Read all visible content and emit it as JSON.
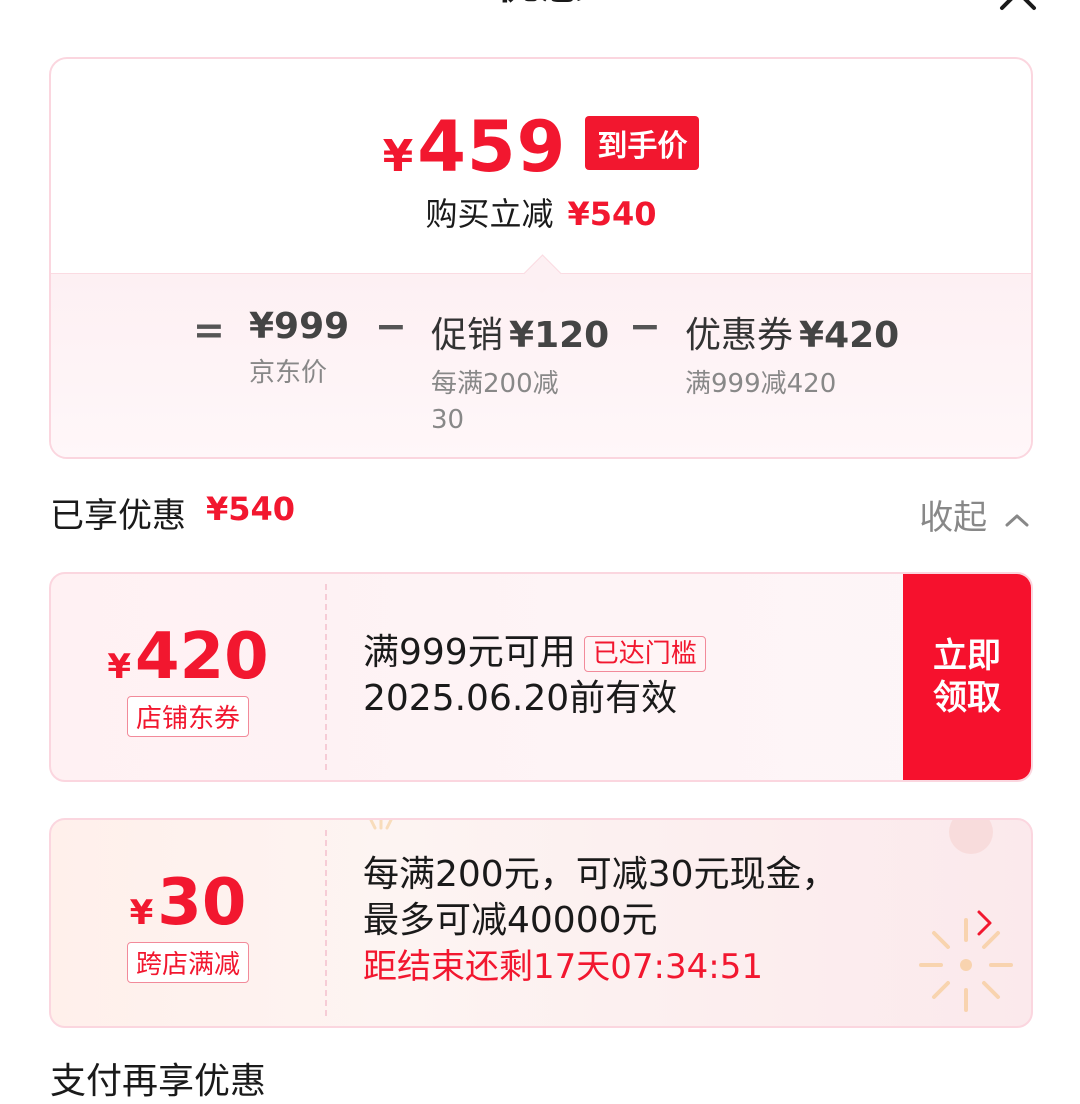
{
  "header": {
    "title": "优惠"
  },
  "summary": {
    "final_price_currency": "¥",
    "final_price": "459",
    "final_tag": "到手价",
    "save_label": "购买立减",
    "save_amount": "¥540",
    "formula": {
      "equals": "=",
      "minus": "−",
      "jd_price": "¥999",
      "jd_price_label": "京东价",
      "promo_prefix": "促销",
      "promo_amount": "¥120",
      "promo_desc": "每满200减30",
      "coupon_prefix": "优惠券",
      "coupon_amount": "¥420",
      "coupon_desc": "满999减420"
    }
  },
  "applied": {
    "title": "已享优惠",
    "amount": "¥540",
    "collapse_label": "收起"
  },
  "coupons": [
    {
      "currency": "¥",
      "amount": "420",
      "type": "店铺东券",
      "condition": "满999元可用",
      "condition_tag": "已达门槛",
      "validity": "2025.06.20前有效",
      "action": "立即领取"
    },
    {
      "currency": "¥",
      "amount": "30",
      "type": "跨店满减",
      "line1": "每满200元，可减30元现金，",
      "line2": "最多可减40000元",
      "countdown": "距结束还剩17天07:34:51"
    }
  ],
  "next_section": {
    "title": "支付再享优惠"
  },
  "colors": {
    "accent": "#f2172f",
    "border": "#fbd6df"
  }
}
